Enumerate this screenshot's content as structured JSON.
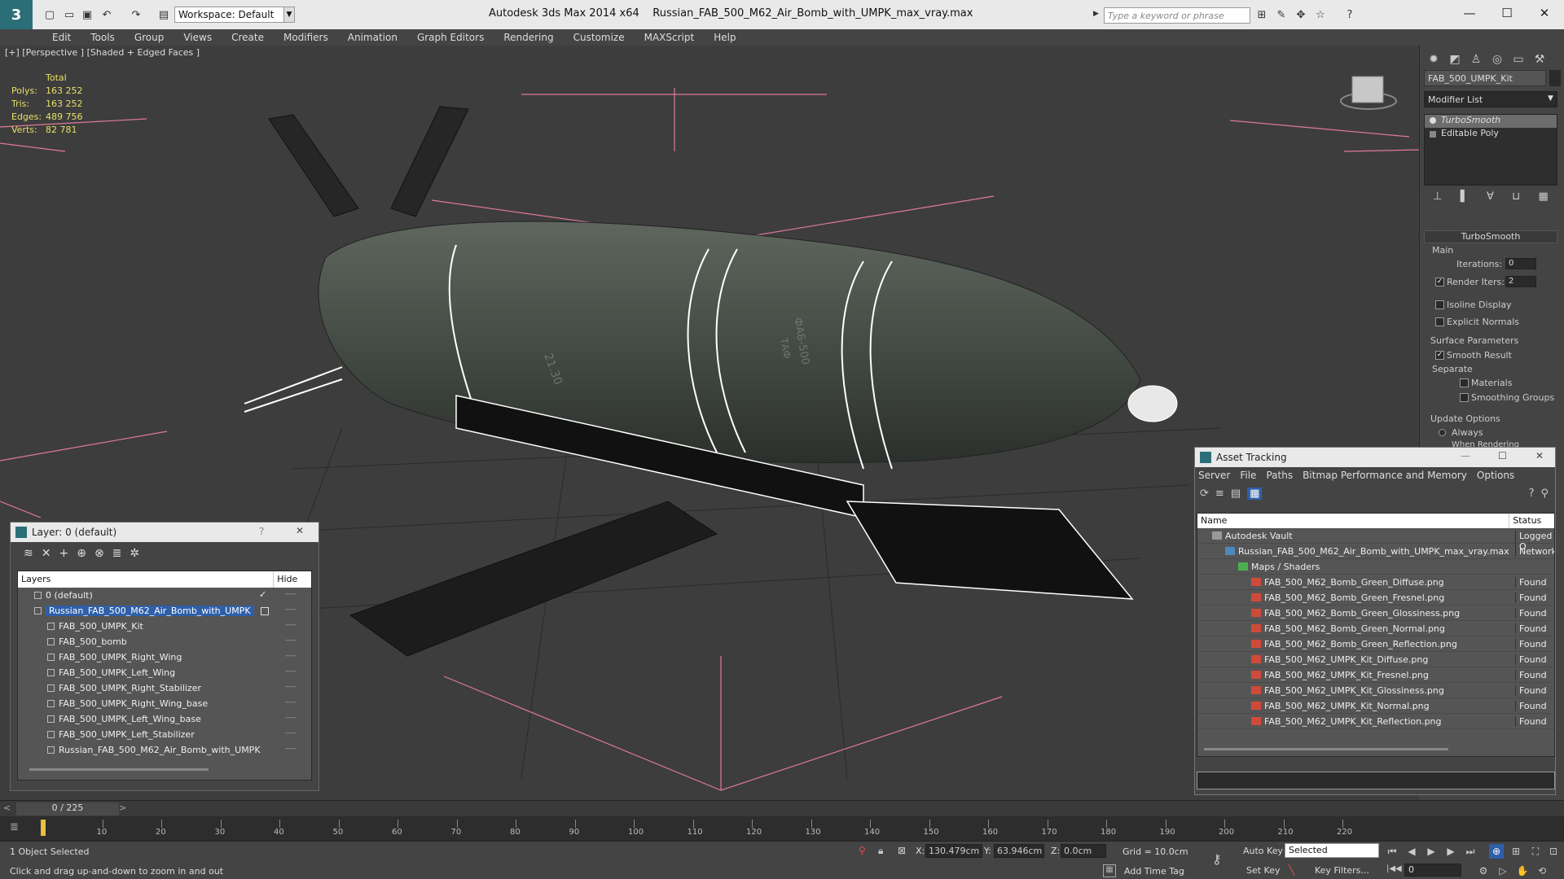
{
  "window": {
    "app": "Autodesk 3ds Max  2014 x64",
    "file": "Russian_FAB_500_M62_Air_Bomb_with_UMPK_max_vray.max",
    "workspace": "Workspace: Default",
    "search_placeholder": "Type a keyword or phrase",
    "logo": "3"
  },
  "menu": [
    "Edit",
    "Tools",
    "Group",
    "Views",
    "Create",
    "Modifiers",
    "Animation",
    "Graph Editors",
    "Rendering",
    "Customize",
    "MAXScript",
    "Help"
  ],
  "viewport": {
    "label": "[+] [Perspective ] [Shaded + Edged Faces ]",
    "stats": {
      "header": "Total",
      "rows": [
        {
          "k": "Polys:",
          "v": "163 252"
        },
        {
          "k": "Tris:",
          "v": "163 252"
        },
        {
          "k": "Edges:",
          "v": "489 756"
        },
        {
          "k": "Verts:",
          "v": "82 781"
        }
      ]
    },
    "text_on_bomb": [
      "21.30",
      "ФАБ-500",
      "ТАФ"
    ]
  },
  "command_panel": {
    "object_name": "FAB_500_UMPK_Kit",
    "modifier_list": "Modifier List",
    "stack": [
      "TurboSmooth",
      "Editable Poly"
    ],
    "rollout": "TurboSmooth",
    "main_label": "Main",
    "iterations_label": "Iterations:",
    "iterations_value": "0",
    "render_iters_label": "Render Iters:",
    "render_iters_value": "2",
    "isoline_label": "Isoline Display",
    "explicit_label": "Explicit Normals",
    "surface_label": "Surface Parameters",
    "smooth_result_label": "Smooth Result",
    "separate_label": "Separate",
    "materials_label": "Materials",
    "smoothing_groups_label": "Smoothing Groups",
    "update_label": "Update Options",
    "always_label": "Always",
    "when_rendering_label": "When Rendering"
  },
  "layer_dialog": {
    "title": "Layer: 0 (default)",
    "help": "?",
    "close": "✕",
    "col_layers": "Layers",
    "col_hide": "Hide",
    "rows": [
      {
        "name": "0 (default)",
        "level": 0,
        "check": "✓"
      },
      {
        "name": "Russian_FAB_500_M62_Air_Bomb_with_UMPK",
        "level": 0,
        "selected": true
      },
      {
        "name": "FAB_500_UMPK_Kit",
        "level": 1
      },
      {
        "name": "FAB_500_bomb",
        "level": 1
      },
      {
        "name": "FAB_500_UMPK_Right_Wing",
        "level": 1
      },
      {
        "name": "FAB_500_UMPK_Left_Wing",
        "level": 1
      },
      {
        "name": "FAB_500_UMPK_Right_Stabilizer",
        "level": 1
      },
      {
        "name": "FAB_500_UMPK_Right_Wing_base",
        "level": 1
      },
      {
        "name": "FAB_500_UMPK_Left_Wing_base",
        "level": 1
      },
      {
        "name": "FAB_500_UMPK_Left_Stabilizer",
        "level": 1
      },
      {
        "name": "Russian_FAB_500_M62_Air_Bomb_with_UMPK",
        "level": 1
      }
    ],
    "hide_mark": "----"
  },
  "asset_dialog": {
    "title": "Asset Tracking",
    "menu": [
      "Server",
      "File",
      "Paths",
      "Bitmap Performance and Memory",
      "Options"
    ],
    "col_name": "Name",
    "col_status": "Status",
    "rows": [
      {
        "name": "Autodesk Vault",
        "status": "Logged O",
        "indent": 18,
        "kind": "vault"
      },
      {
        "name": "Russian_FAB_500_M62_Air_Bomb_with_UMPK_max_vray.max",
        "status": "Network",
        "indent": 34,
        "kind": "max"
      },
      {
        "name": "Maps / Shaders",
        "status": "",
        "indent": 50,
        "kind": "folder"
      },
      {
        "name": "FAB_500_M62_Bomb_Green_Diffuse.png",
        "status": "Found",
        "indent": 66,
        "kind": "png"
      },
      {
        "name": "FAB_500_M62_Bomb_Green_Fresnel.png",
        "status": "Found",
        "indent": 66,
        "kind": "png"
      },
      {
        "name": "FAB_500_M62_Bomb_Green_Glossiness.png",
        "status": "Found",
        "indent": 66,
        "kind": "png"
      },
      {
        "name": "FAB_500_M62_Bomb_Green_Normal.png",
        "status": "Found",
        "indent": 66,
        "kind": "png"
      },
      {
        "name": "FAB_500_M62_Bomb_Green_Reflection.png",
        "status": "Found",
        "indent": 66,
        "kind": "png"
      },
      {
        "name": "FAB_500_M62_UMPK_Kit_Diffuse.png",
        "status": "Found",
        "indent": 66,
        "kind": "png"
      },
      {
        "name": "FAB_500_M62_UMPK_Kit_Fresnel.png",
        "status": "Found",
        "indent": 66,
        "kind": "png"
      },
      {
        "name": "FAB_500_M62_UMPK_Kit_Glossiness.png",
        "status": "Found",
        "indent": 66,
        "kind": "png"
      },
      {
        "name": "FAB_500_M62_UMPK_Kit_Normal.png",
        "status": "Found",
        "indent": 66,
        "kind": "png"
      },
      {
        "name": "FAB_500_M62_UMPK_Kit_Reflection.png",
        "status": "Found",
        "indent": 66,
        "kind": "png"
      }
    ]
  },
  "timeline": {
    "frame_counter": "0 / 225",
    "ticks": [
      "10",
      "20",
      "30",
      "40",
      "50",
      "60",
      "70",
      "80",
      "90",
      "100",
      "110",
      "120",
      "130",
      "140",
      "150",
      "160",
      "170",
      "180",
      "190",
      "200",
      "210",
      "220"
    ]
  },
  "status": {
    "selected": "1 Object Selected",
    "prompt": "Click and drag up-and-down to zoom in and out",
    "x_label": "X:",
    "x_value": "130.479cm",
    "y_label": "Y:",
    "y_value": "63.946cm",
    "z_label": "Z:",
    "z_value": "0.0cm",
    "grid": "Grid = 10.0cm",
    "add_time_tag": "Add Time Tag",
    "auto_key": "Auto Key",
    "set_key": "Set Key",
    "key_mode": "Selected",
    "key_filters": "Key Filters...",
    "frame": "0"
  },
  "colors": {
    "viewport_bg": "#3d3d3d",
    "bomb_body": "#4a524a",
    "wireframe": "#ffffff",
    "bbox_pink": "#e07a9a",
    "stats_yellow": "#e8e066",
    "selection_blue": "#2f5fa8"
  }
}
